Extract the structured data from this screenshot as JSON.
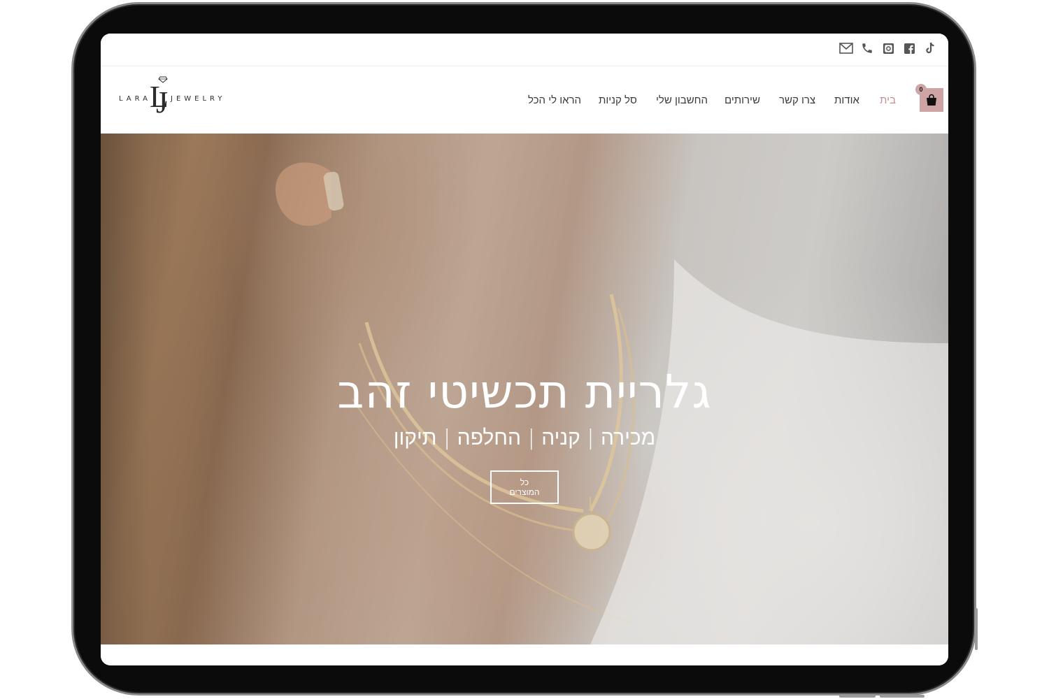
{
  "social_icons": [
    "tiktok-icon",
    "facebook-icon",
    "instagram-icon",
    "phone-icon",
    "mail-icon"
  ],
  "logo": {
    "left_word": "LARA",
    "right_word": "JEWELRY",
    "monogram_1": "L",
    "monogram_2": "J"
  },
  "nav": {
    "items": [
      "בית",
      "אודות",
      "צרו קשר",
      "שירותים",
      "החשבון שלי",
      "סל קניות",
      "הראו לי הכל"
    ],
    "active_index": 0
  },
  "cart": {
    "count": "0"
  },
  "hero": {
    "title": "גלריית תכשיטי זהב",
    "subtitle": "מכירה | קניה | החלפה | תיקון",
    "button_label": "כל המוצרים"
  },
  "colors": {
    "accent": "#c58f8f",
    "cart_bg": "#cfa4a4",
    "frame": "#0b0b0b"
  }
}
